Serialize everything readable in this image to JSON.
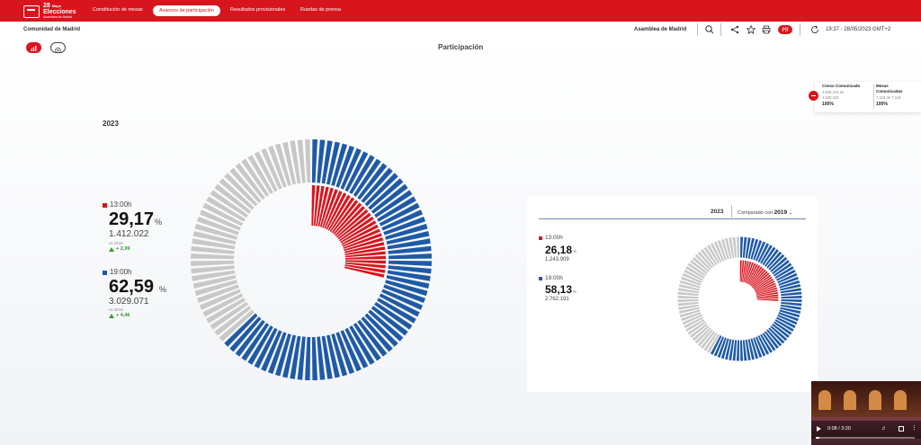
{
  "logo": {
    "day": "28",
    "sup": "Mayo",
    "word": "Elecciones",
    "sub": "Asamblea de Madrid"
  },
  "nav": [
    {
      "label": "Constitución de mesas",
      "active": false
    },
    {
      "label": "Avances de participación",
      "active": true
    },
    {
      "label": "Resultados provisionales",
      "active": false
    },
    {
      "label": "Ruedas de prensa",
      "active": false
    }
  ],
  "header": {
    "region": "Comunidad de Madrid",
    "assembly": "Asamblea de Madrid",
    "icons": [
      "search-icon",
      "share-icon",
      "star-icon",
      "print-icon",
      "live-icon",
      "refresh-icon"
    ],
    "live_badge": "(•))",
    "time": "19:37 - 28/05/2023 GMT+2"
  },
  "page_title": "Participación",
  "census": {
    "censo_label": "Censo Comunicado",
    "censo_values": "4.839.234 de",
    "censo_total": "4.839.234",
    "censo_pct": "100%",
    "mesas_label": "Mesas",
    "mesas_label2": "Comunicadas",
    "mesas_values": "7.118 de 7.118",
    "mesas_pct": "100%"
  },
  "main": {
    "year": "2023",
    "first": {
      "time": "13:00h",
      "value": "29,17",
      "unit": "%",
      "count": "1.412.022",
      "vs": "vs 2019",
      "delta": "+ 2,99"
    },
    "second": {
      "time": "19:00h",
      "value": "62,59",
      "unit": "%",
      "count": "3.029.071",
      "vs": "vs 2019",
      "delta": "+ 4,46"
    }
  },
  "compare": {
    "year": "2023",
    "compare_label": "Comparado con",
    "compare_year": "2019",
    "first": {
      "time": "13:00h",
      "value": "26,18",
      "unit": "%",
      "count": "1.243.909"
    },
    "second": {
      "time": "19:00h",
      "value": "58,13",
      "unit": "%",
      "count": "2.762.191"
    }
  },
  "video": {
    "time": "0:08 / 3:20",
    "progress": 0.04
  },
  "colors": {
    "red": "#d8151d",
    "blue": "#1f5aa6",
    "grey": "#c8c8c8"
  },
  "chart_data": [
    {
      "type": "pie",
      "title": "",
      "series": [
        {
          "name": "13:00h",
          "values": [
            29.17
          ]
        },
        {
          "name": "19:00h",
          "values": [
            62.59
          ]
        }
      ]
    },
    {
      "type": "pie",
      "title": "",
      "series": [
        {
          "name": "13:00h",
          "values": [
            26.18
          ]
        },
        {
          "name": "19:00h",
          "values": [
            58.13
          ]
        }
      ]
    }
  ]
}
